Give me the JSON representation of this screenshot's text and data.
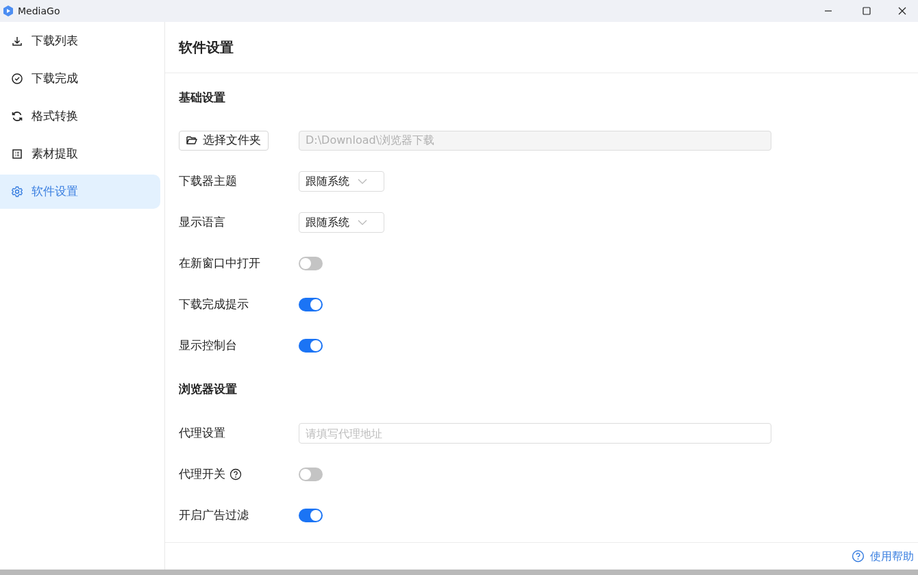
{
  "window": {
    "title": "MediaGo"
  },
  "sidebar": {
    "items": [
      {
        "label": "下载列表",
        "selected": false
      },
      {
        "label": "下载完成",
        "selected": false
      },
      {
        "label": "格式转换",
        "selected": false
      },
      {
        "label": "素材提取",
        "selected": false
      },
      {
        "label": "软件设置",
        "selected": true
      }
    ]
  },
  "page_title": "软件设置",
  "sections": [
    {
      "title": "基础设置",
      "rows": [
        {
          "kind": "folder",
          "button": "选择文件夹",
          "value": "D:\\Download\\浏览器下载",
          "disabled": true
        },
        {
          "kind": "select",
          "label": "下载器主题",
          "value": "跟随系统"
        },
        {
          "kind": "select",
          "label": "显示语言",
          "value": "跟随系统"
        },
        {
          "kind": "toggle",
          "label": "在新窗口中打开",
          "on": false
        },
        {
          "kind": "toggle",
          "label": "下载完成提示",
          "on": true
        },
        {
          "kind": "toggle",
          "label": "显示控制台",
          "on": true
        }
      ]
    },
    {
      "title": "浏览器设置",
      "rows": [
        {
          "kind": "input",
          "label": "代理设置",
          "placeholder": "请填写代理地址"
        },
        {
          "kind": "toggle",
          "label": "代理开关",
          "help": true,
          "on": false
        },
        {
          "kind": "toggle",
          "label": "开启广告过滤",
          "on": true
        }
      ]
    }
  ],
  "footer": {
    "help_link": "使用帮助"
  }
}
